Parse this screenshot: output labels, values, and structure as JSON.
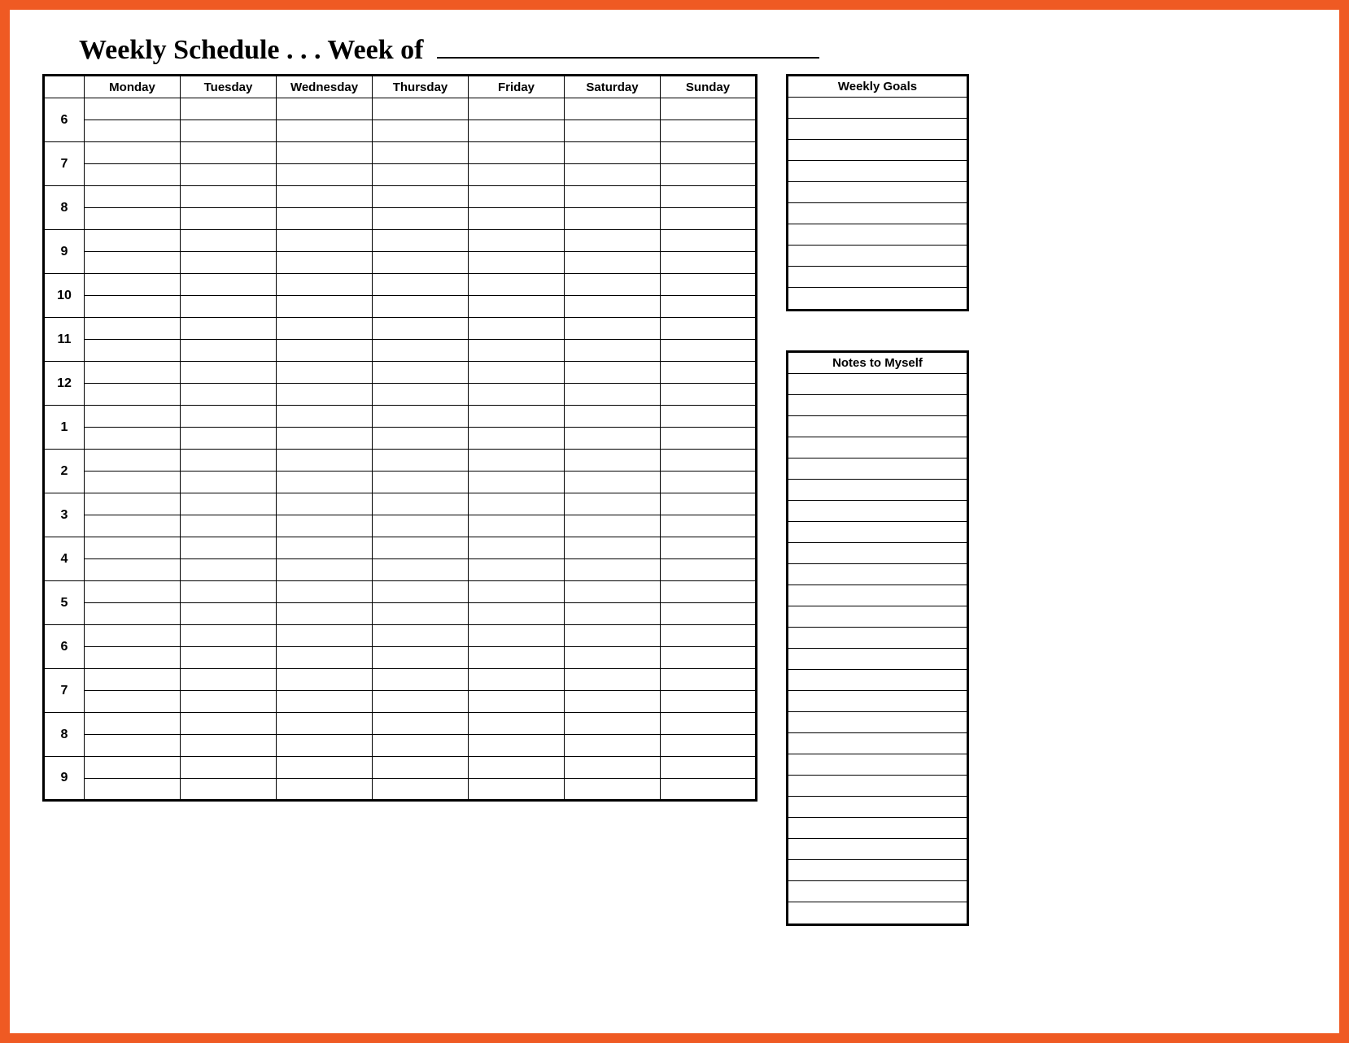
{
  "header": {
    "title": "Weekly Schedule . . . Week of ",
    "week_of_value": ""
  },
  "schedule": {
    "days": [
      "Monday",
      "Tuesday",
      "Wednesday",
      "Thursday",
      "Friday",
      "Saturday",
      "Sunday"
    ],
    "hours": [
      "6",
      "7",
      "8",
      "9",
      "10",
      "11",
      "12",
      "1",
      "2",
      "3",
      "4",
      "5",
      "6",
      "7",
      "8",
      "9"
    ],
    "subrows_per_hour": 2
  },
  "goals": {
    "title": "Weekly Goals",
    "lines": 10
  },
  "notes": {
    "title": "Notes to Myself",
    "lines": 26
  }
}
